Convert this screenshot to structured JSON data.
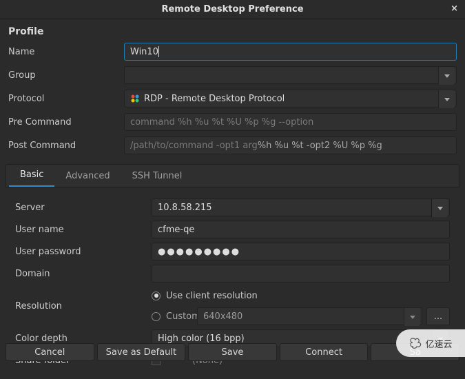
{
  "titlebar": {
    "title": "Remote Desktop Preference",
    "close": "×"
  },
  "profile": {
    "heading": "Profile",
    "name_label": "Name",
    "name_value": "Win10",
    "group_label": "Group",
    "group_value": "",
    "protocol_label": "Protocol",
    "protocol_value": "RDP - Remote Desktop Protocol",
    "precmd_label": "Pre Command",
    "precmd_placeholder": "command %h %u %t %U %p %g --option",
    "postcmd_label": "Post Command",
    "postcmd_placeholder_prefix": "/path/to/command -opt1 arg ",
    "postcmd_placeholder_suffix": "%h %u %t -opt2 %U %p %g"
  },
  "tabs": {
    "basic": "Basic",
    "advanced": "Advanced",
    "ssh": "SSH Tunnel"
  },
  "basic": {
    "server_label": "Server",
    "server_value": "10.8.58.215",
    "user_label": "User name",
    "user_value": "cfme-qe",
    "pwd_label": "User password",
    "pwd_value": "●●●●●●●●●",
    "domain_label": "Domain",
    "domain_value": "",
    "res_label": "Resolution",
    "res_client": "Use client resolution",
    "res_custom": "Custom",
    "res_custom_value": "640x480",
    "dots": "...",
    "color_label": "Color depth",
    "color_value": "High color (16 bpp)",
    "share_label": "Share folder",
    "share_value": "(None)"
  },
  "actions": {
    "cancel": "Cancel",
    "default": "Save as Default",
    "save": "Save",
    "connect": "Connect",
    "save_connect": "Sa"
  },
  "watermark": "亿速云"
}
